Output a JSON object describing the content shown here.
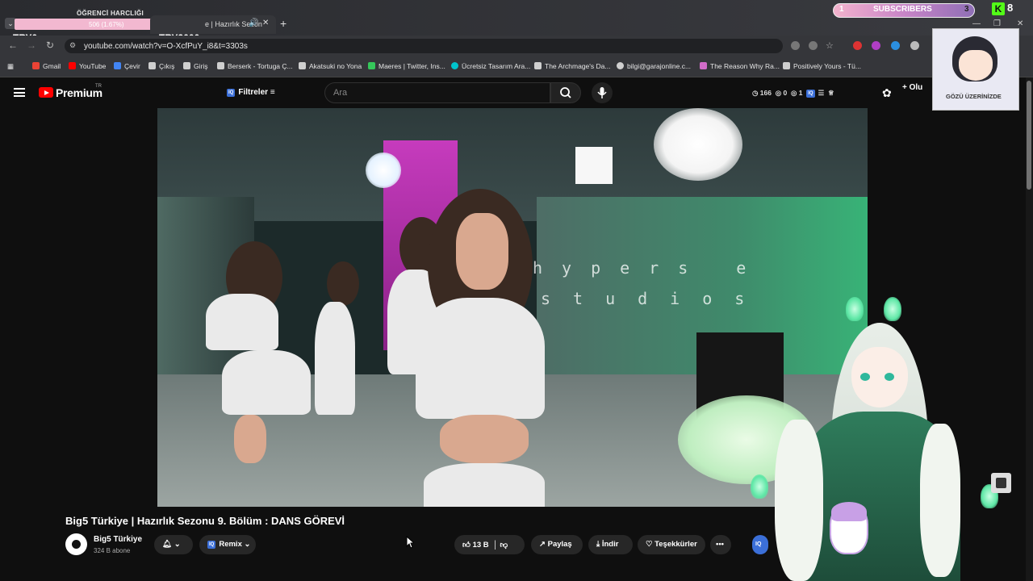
{
  "overlay": {
    "bar_title": "ÖĞRENCİ HARCLIĞI",
    "bar_value": "506 (1.67%)",
    "try_left": "TRY0",
    "try_right": "TRY3000",
    "subscriber_count_left": "1",
    "subscriber_label": "SUBSCRIBERS",
    "subscriber_count_right": "3",
    "kick_count": "8",
    "cam_caption": "GÖZÜ ÜZERİNİZDE"
  },
  "browser": {
    "tab_title": "e | Hazırlık Sezon",
    "url": "youtube.com/watch?v=O-XcfPuY_i8&t=3303s",
    "bookmarks": [
      {
        "label": "Gmail",
        "color": "#ea4335"
      },
      {
        "label": "YouTube",
        "color": "#ff0000"
      },
      {
        "label": "Çevir",
        "color": "#4285f4"
      },
      {
        "label": "Çıkış",
        "color": "#cfcfcf"
      },
      {
        "label": "Giriş",
        "color": "#cfcfcf"
      },
      {
        "label": "Berserk - Tortuga Ç...",
        "color": "#cfcfcf"
      },
      {
        "label": "Akatsuki no Yona",
        "color": "#cfcfcf"
      },
      {
        "label": "Maeres | Twitter, Ins...",
        "color": "#35c75a"
      },
      {
        "label": "Ücretsiz Tasarım Ara...",
        "color": "#00c4cc"
      },
      {
        "label": "The Archmage's Da...",
        "color": "#cfcfcf"
      },
      {
        "label": "bilgi@garajonline.c...",
        "color": "#cfcfcf"
      },
      {
        "label": "The Reason Why Ra...",
        "color": "#d26cc9"
      },
      {
        "label": "Positively Yours - Tü...",
        "color": "#cfcfcf"
      }
    ]
  },
  "youtube": {
    "brand": "Premium",
    "region": "TR",
    "filters_label": "Filtreler",
    "search_placeholder": "Ara",
    "stat_views": "166",
    "stat_a": "0",
    "stat_b": "1",
    "create_label": "Olu"
  },
  "video": {
    "brand_line1": "hypers e",
    "brand_line2": "studios",
    "title": "Big5 Türkiye | Hazırlık Sezonu 9. Bölüm : DANS GÖREVİ",
    "channel_name": "Big5 Türkiye",
    "channel_subs": "324 B abone",
    "remix_label": "Remix",
    "like_count": "13 B",
    "share_label": "Paylaş",
    "download_label": "İndir",
    "thanks_label": "Teşekkürler"
  },
  "colors": {
    "accent": "#ff0000",
    "iq_blue": "#3b6fd8",
    "kick_green": "#53fc18"
  }
}
